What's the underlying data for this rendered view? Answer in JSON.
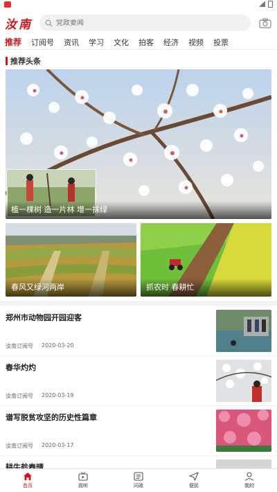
{
  "header": {
    "logo": "汝南",
    "search_placeholder": "党政要闻"
  },
  "tabs": [
    "推荐",
    "订阅号",
    "资讯",
    "学习",
    "文化",
    "拍客",
    "经济",
    "视频",
    "投票"
  ],
  "section": {
    "title": "推荐头条"
  },
  "hero": {
    "caption": "植一棵树 造一片林 增一抹绿"
  },
  "cards": [
    {
      "caption": "春风又绿河两岸"
    },
    {
      "caption": "抓农时 春耕忙"
    }
  ],
  "news": [
    {
      "title": "郑州市动物园开园迎客",
      "source": "汝南订阅号",
      "date": "2020-03-20"
    },
    {
      "title": "春华灼灼",
      "source": "汝南订阅号",
      "date": "2020-03-19"
    },
    {
      "title": "谱写脱贫攻坚的历史性篇章",
      "source": "汝南订阅号",
      "date": "2020-03-17"
    },
    {
      "title": "耕牛趁春晴",
      "source": "",
      "date": ""
    }
  ],
  "bottom_nav": [
    {
      "label": "首页",
      "icon": "home-icon",
      "active": true
    },
    {
      "label": "视听",
      "icon": "tv-icon",
      "active": false
    },
    {
      "label": "问政",
      "icon": "politics-icon",
      "active": false
    },
    {
      "label": "便民",
      "icon": "send-icon",
      "active": false
    },
    {
      "label": "我的",
      "icon": "user-icon",
      "active": false
    }
  ],
  "colors": {
    "accent": "#d3141a"
  }
}
